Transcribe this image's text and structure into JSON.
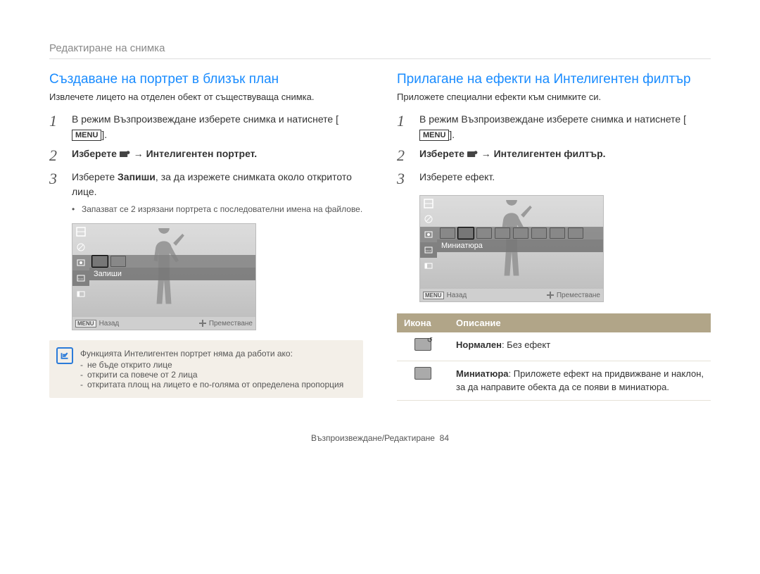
{
  "breadcrumb": "Редактиране на снимка",
  "left": {
    "title": "Създаване на портрет в близък план",
    "lead": "Извлечете лицето на отделен обект от съществуваща снимка.",
    "step1_a": "В режим Възпроизвеждане изберете снимка и натиснете [",
    "step1_menu": "MENU",
    "step1_b": "].",
    "step2_a": "Изберете ",
    "step2_b": " → Интелигентен портрет.",
    "step3_a": "Изберете ",
    "step3_b": "Запиши",
    "step3_c": ", за да изрежете снимката около откритото лице.",
    "step3_bullet": "Запазват се 2 изрязани портрета с последователни имена на файлове.",
    "preview_label": "Запиши",
    "preview_back": "Назад",
    "preview_move": "Преместване",
    "preview_menu": "MENU",
    "note_title": "Функцията Интелигентен портрет няма да работи ако:",
    "note_items": [
      "не бъде открито лице",
      "открити са повече от 2 лица",
      "откритата площ на лицето е по-голяма от определена пропорция"
    ]
  },
  "right": {
    "title": "Прилагане на ефекти на Интелигентен филтър",
    "lead": "Приложете специални ефекти към снимките си.",
    "step1_a": "В режим Възпроизвеждане изберете снимка и натиснете [",
    "step1_menu": "MENU",
    "step1_b": "].",
    "step2_a": "Изберете ",
    "step2_b": " → Интелигентен филтър.",
    "step3": "Изберете ефект.",
    "preview_label": "Миниатюра",
    "preview_back": "Назад",
    "preview_move": "Преместване",
    "preview_menu": "MENU",
    "table": {
      "h_icon": "Икона",
      "h_desc": "Описание",
      "rows": [
        {
          "name": "Нормален",
          "desc": ": Без ефект"
        },
        {
          "name": "Миниатюра",
          "desc": ": Приложете ефект на придвижване и наклон, за да направите обекта да се появи в миниатюра."
        }
      ]
    }
  },
  "footer_a": "Възпроизвеждане/Редактиране",
  "footer_page": "84"
}
